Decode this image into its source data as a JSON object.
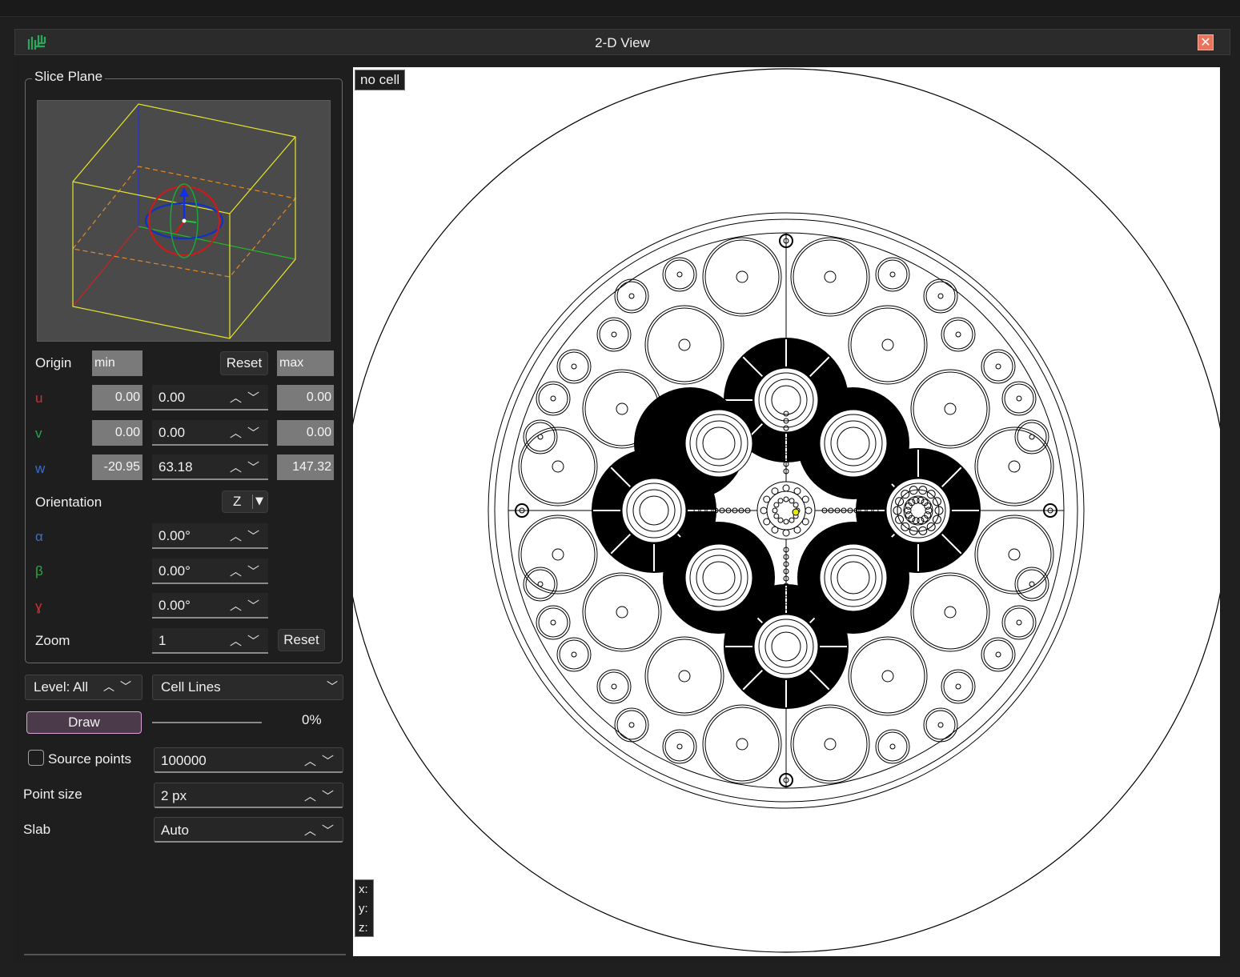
{
  "window": {
    "title": "2-D View",
    "close_label": "✕"
  },
  "slice_plane": {
    "group_label": "Slice Plane",
    "origin_label": "Origin",
    "min_label": "min",
    "max_label": "max",
    "reset_label": "Reset",
    "u": {
      "label": "u",
      "min": "0.00",
      "value": "0.00",
      "max": "0.00"
    },
    "v": {
      "label": "v",
      "min": "0.00",
      "value": "0.00",
      "max": "0.00"
    },
    "w": {
      "label": "w",
      "min": "-20.95",
      "value": "63.18",
      "max": "147.32"
    },
    "orientation_label": "Orientation",
    "orientation_value": "Z",
    "alpha": {
      "label": "α",
      "value": "0.00°"
    },
    "beta": {
      "label": "β",
      "value": "0.00°"
    },
    "gamma": {
      "label": "ɣ",
      "value": "0.00°"
    },
    "zoom_label": "Zoom",
    "zoom_value": "1",
    "zoom_reset_label": "Reset"
  },
  "controls": {
    "level_value": "Level: All",
    "mode_value": "Cell Lines",
    "draw_label": "Draw",
    "progress_text": "0%",
    "progress_fraction": 0.0,
    "source_points_label": "Source points",
    "source_points_checked": false,
    "source_points_value": "100000",
    "point_size_label": "Point size",
    "point_size_value": "2 px",
    "slab_label": "Slab",
    "slab_value": "Auto"
  },
  "viewport": {
    "cell_label": "no cell",
    "x_label": "x:",
    "y_label": "y:",
    "z_label": "z:"
  },
  "colors": {
    "u": "#d03030",
    "v": "#28a848",
    "w": "#3a6fd0",
    "close": "#e8745e",
    "draw_border": "#d9a0d9",
    "accent_yellow": "#e8e800"
  },
  "icons": [
    "app-logo-icon",
    "close-icon",
    "chevron-up-icon",
    "chevron-down-icon",
    "dropdown-arrow-icon",
    "checkbox-icon"
  ]
}
